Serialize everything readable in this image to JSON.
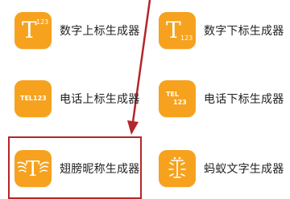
{
  "tools": [
    {
      "label": "数字上标生成器",
      "icon": "t-superscript-icon",
      "icon_main": "T",
      "icon_sub": "123"
    },
    {
      "label": "数字下标生成器",
      "icon": "t-subscript-icon",
      "icon_main": "T",
      "icon_sub": "123"
    },
    {
      "label": "电话上标生成器",
      "icon": "tel-superscript-icon",
      "icon_main": "TEL123"
    },
    {
      "label": "电话下标生成器",
      "icon": "tel-subscript-icon",
      "icon_main": "TEL",
      "icon_sub": "123"
    },
    {
      "label": "翅膀昵称生成器",
      "icon": "winged-t-icon",
      "icon_main": "T"
    },
    {
      "label": "蚂蚁文字生成器",
      "icon": "ant-text-icon"
    }
  ],
  "colors": {
    "icon_bg": "#f6a21e",
    "highlight": "#b3262a"
  }
}
